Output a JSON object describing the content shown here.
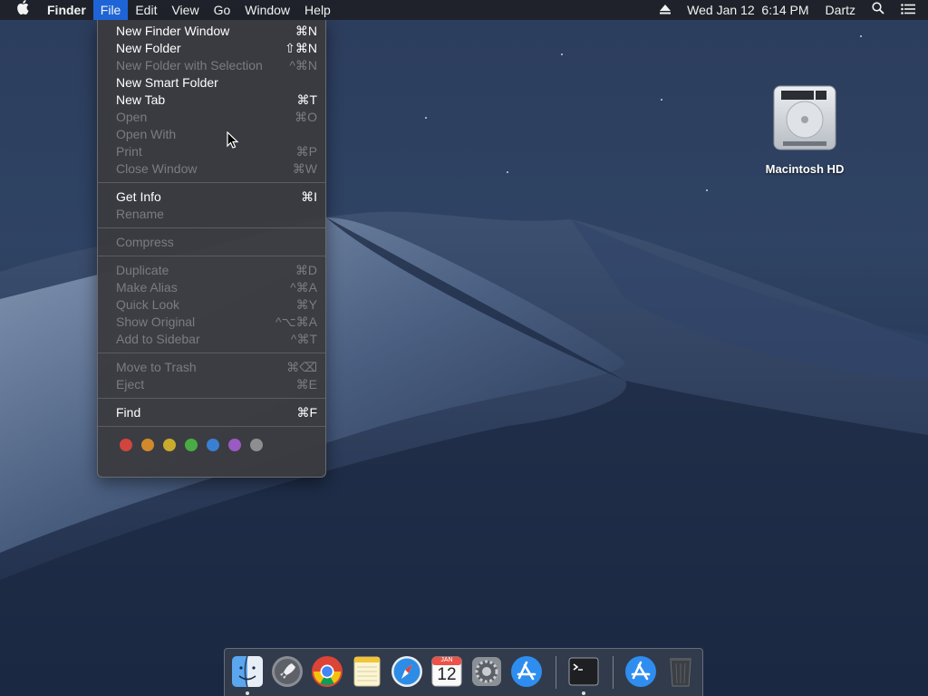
{
  "menubar": {
    "app_name": "Finder",
    "menus": [
      "File",
      "Edit",
      "View",
      "Go",
      "Window",
      "Help"
    ],
    "active_menu": "File",
    "clock": "Wed Jan 12  6:14 PM",
    "user": "Dartz",
    "icons": [
      "apple-icon",
      "eject-icon",
      "search-icon",
      "list-icon"
    ]
  },
  "file_menu": {
    "groups": [
      [
        {
          "label": "New Finder Window",
          "shortcut": "⌘N",
          "enabled": true
        },
        {
          "label": "New Folder",
          "shortcut": "⇧⌘N",
          "enabled": true
        },
        {
          "label": "New Folder with Selection",
          "shortcut": "^⌘N",
          "enabled": false
        },
        {
          "label": "New Smart Folder",
          "shortcut": "",
          "enabled": true
        },
        {
          "label": "New Tab",
          "shortcut": "⌘T",
          "enabled": true
        },
        {
          "label": "Open",
          "shortcut": "⌘O",
          "enabled": false
        },
        {
          "label": "Open With",
          "shortcut": "",
          "enabled": false
        },
        {
          "label": "Print",
          "shortcut": "⌘P",
          "enabled": false
        },
        {
          "label": "Close Window",
          "shortcut": "⌘W",
          "enabled": false
        }
      ],
      [
        {
          "label": "Get Info",
          "shortcut": "⌘I",
          "enabled": true
        },
        {
          "label": "Rename",
          "shortcut": "",
          "enabled": false
        }
      ],
      [
        {
          "label": "Compress",
          "shortcut": "",
          "enabled": false
        }
      ],
      [
        {
          "label": "Duplicate",
          "shortcut": "⌘D",
          "enabled": false
        },
        {
          "label": "Make Alias",
          "shortcut": "^⌘A",
          "enabled": false
        },
        {
          "label": "Quick Look",
          "shortcut": "⌘Y",
          "enabled": false
        },
        {
          "label": "Show Original",
          "shortcut": "^⌥⌘A",
          "enabled": false
        },
        {
          "label": "Add to Sidebar",
          "shortcut": "^⌘T",
          "enabled": false
        }
      ],
      [
        {
          "label": "Move to Trash",
          "shortcut": "⌘⌫",
          "enabled": false
        },
        {
          "label": "Eject",
          "shortcut": "⌘E",
          "enabled": false
        }
      ],
      [
        {
          "label": "Find",
          "shortcut": "⌘F",
          "enabled": true
        }
      ]
    ],
    "tag_colors": [
      "#d0453f",
      "#d08a2c",
      "#c9ac2c",
      "#4aab45",
      "#3a7fd2",
      "#9a5ac2",
      "#8e8e90"
    ]
  },
  "desktop": {
    "icons": [
      {
        "label": "Macintosh HD",
        "icon": "hard-drive-icon"
      }
    ]
  },
  "dock": {
    "apps": [
      {
        "name": "finder-icon",
        "running": true
      },
      {
        "name": "launchpad-icon",
        "running": false
      },
      {
        "name": "chrome-icon",
        "running": false
      },
      {
        "name": "notes-icon",
        "running": false
      },
      {
        "name": "safari-icon",
        "running": false
      },
      {
        "name": "calendar-icon",
        "running": false,
        "month": "JAN",
        "day": "12"
      },
      {
        "name": "system-preferences-icon",
        "running": false
      },
      {
        "name": "app-store-icon",
        "running": false
      },
      {
        "name": "terminal-icon",
        "running": true
      },
      {
        "name": "downloads-stack-icon",
        "running": false
      },
      {
        "name": "trash-icon",
        "running": false
      }
    ]
  }
}
